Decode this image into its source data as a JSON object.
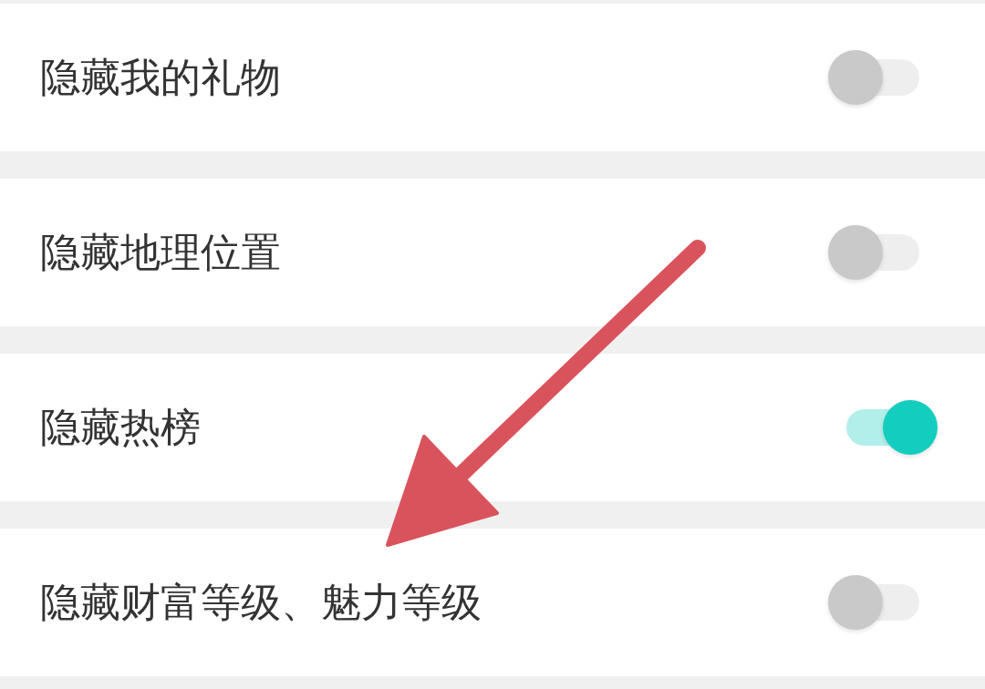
{
  "rows": [
    {
      "label": "隐藏我的礼物",
      "on": false
    },
    {
      "label": "隐藏地理位置",
      "on": false
    },
    {
      "label": "隐藏热榜",
      "on": true
    },
    {
      "label": "隐藏财富等级、魅力等级",
      "on": false
    }
  ]
}
